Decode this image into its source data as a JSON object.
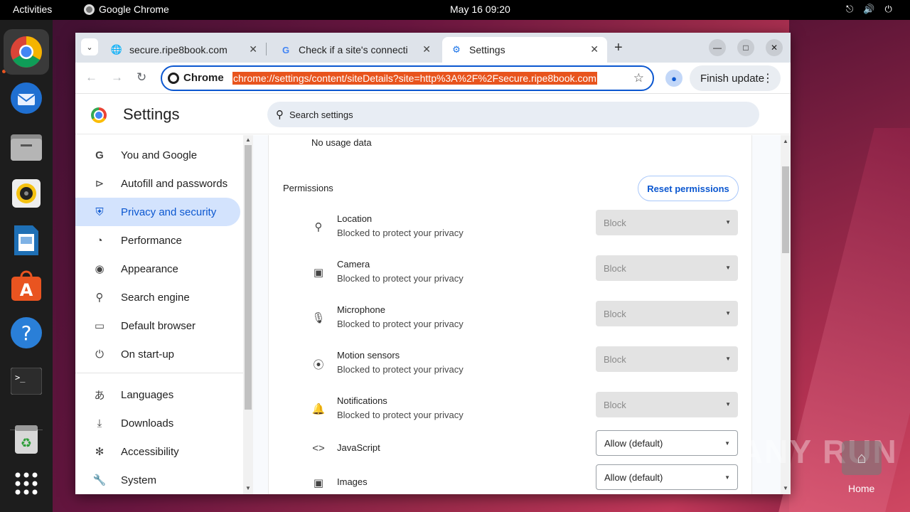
{
  "topbar": {
    "activities": "Activities",
    "app_name": "Google Chrome",
    "clock": "May 16  09:20"
  },
  "browser": {
    "tabs": [
      {
        "title": "secure.ripe8book.com",
        "favicon": "globe-icon"
      },
      {
        "title": "Check if a site's connecti",
        "favicon": "google-icon"
      },
      {
        "title": "Settings",
        "favicon": "gear-icon"
      }
    ],
    "omnibox": {
      "chip": "Chrome",
      "url": "chrome://settings/content/siteDetails?site=http%3A%2F%2Fsecure.ripe8book.com"
    },
    "finish_update": "Finish update"
  },
  "settings": {
    "title": "Settings",
    "search_placeholder": "Search settings",
    "sidebar": [
      {
        "label": "You and Google",
        "icon": "google-g-icon"
      },
      {
        "label": "Autofill and passwords",
        "icon": "key-icon"
      },
      {
        "label": "Privacy and security",
        "icon": "shield-icon",
        "selected": true
      },
      {
        "label": "Performance",
        "icon": "speedometer-icon"
      },
      {
        "label": "Appearance",
        "icon": "palette-icon"
      },
      {
        "label": "Search engine",
        "icon": "search-icon"
      },
      {
        "label": "Default browser",
        "icon": "browser-window-icon"
      },
      {
        "label": "On start-up",
        "icon": "power-icon"
      },
      {
        "label": "Languages",
        "icon": "translate-icon"
      },
      {
        "label": "Downloads",
        "icon": "download-icon"
      },
      {
        "label": "Accessibility",
        "icon": "accessibility-icon"
      },
      {
        "label": "System",
        "icon": "wrench-icon"
      }
    ],
    "usage": "No usage data",
    "permissions_heading": "Permissions",
    "reset_button": "Reset permissions",
    "permissions": [
      {
        "name": "Location",
        "sub": "Blocked to protect your privacy",
        "value": "Block",
        "icon": "location-pin-icon",
        "enabled": false
      },
      {
        "name": "Camera",
        "sub": "Blocked to protect your privacy",
        "value": "Block",
        "icon": "camera-icon",
        "enabled": false
      },
      {
        "name": "Microphone",
        "sub": "Blocked to protect your privacy",
        "value": "Block",
        "icon": "microphone-icon",
        "enabled": false
      },
      {
        "name": "Motion sensors",
        "sub": "Blocked to protect your privacy",
        "value": "Block",
        "icon": "sensors-icon",
        "enabled": false
      },
      {
        "name": "Notifications",
        "sub": "Blocked to protect your privacy",
        "value": "Block",
        "icon": "bell-icon",
        "enabled": false
      },
      {
        "name": "JavaScript",
        "sub": "",
        "value": "Allow (default)",
        "icon": "code-icon",
        "enabled": true
      },
      {
        "name": "Images",
        "sub": "",
        "value": "Allow (default)",
        "icon": "image-icon",
        "enabled": true
      }
    ]
  },
  "desktop": {
    "home_label": "Home",
    "watermark": "ANY RUN"
  },
  "colors": {
    "accent": "#0b57d0",
    "selected_bg": "#d3e3fd",
    "url_highlight": "#e8541d",
    "ubuntu_orange": "#e95420"
  }
}
